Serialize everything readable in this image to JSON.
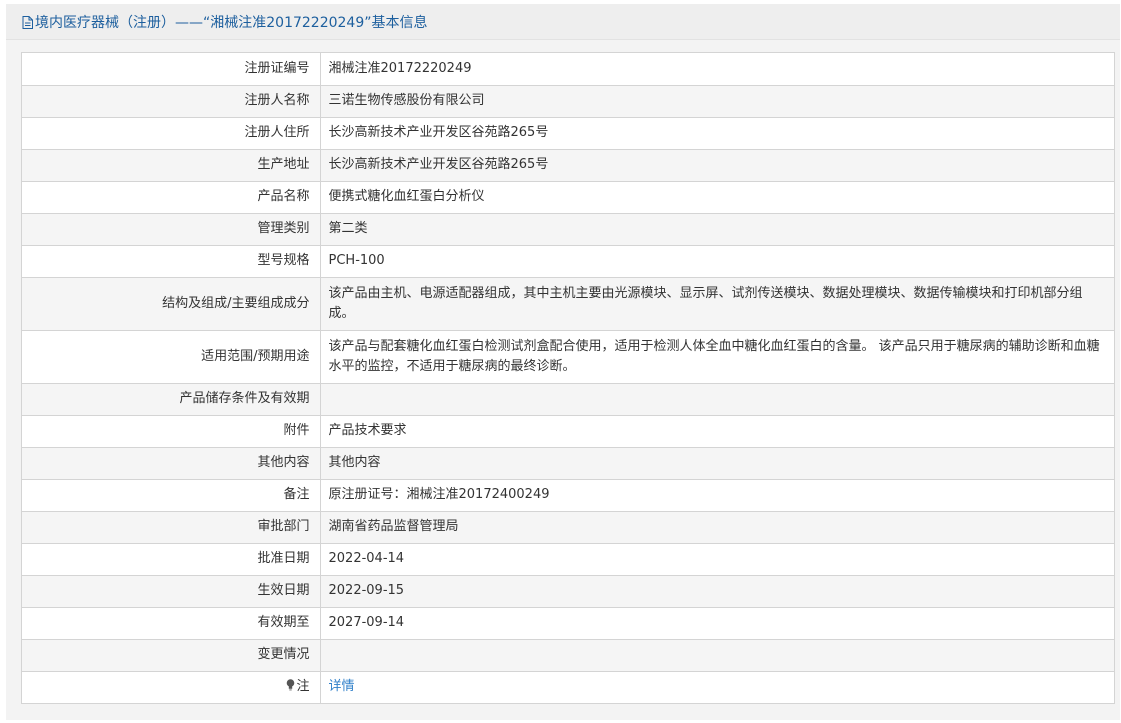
{
  "header": {
    "title": "境内医疗器械（注册）——“湘械注准20172220249”基本信息"
  },
  "rows": [
    {
      "label": "注册证编号",
      "value": "湘械注准20172220249"
    },
    {
      "label": "注册人名称",
      "value": "三诺生物传感股份有限公司"
    },
    {
      "label": "注册人住所",
      "value": "长沙高新技术产业开发区谷苑路265号"
    },
    {
      "label": "生产地址",
      "value": "长沙高新技术产业开发区谷苑路265号"
    },
    {
      "label": "产品名称",
      "value": "便携式糖化血红蛋白分析仪"
    },
    {
      "label": "管理类别",
      "value": "第二类"
    },
    {
      "label": "型号规格",
      "value": "PCH-100"
    },
    {
      "label": "结构及组成/主要组成成分",
      "value": "该产品由主机、电源适配器组成，其中主机主要由光源模块、显示屏、试剂传送模块、数据处理模块、数据传输模块和打印机部分组成。"
    },
    {
      "label": "适用范围/预期用途",
      "value": "该产品与配套糖化血红蛋白检测试剂盒配合使用，适用于检测人体全血中糖化血红蛋白的含量。 该产品只用于糖尿病的辅助诊断和血糖水平的监控，不适用于糖尿病的最终诊断。"
    },
    {
      "label": "产品储存条件及有效期",
      "value": ""
    },
    {
      "label": "附件",
      "value": "产品技术要求"
    },
    {
      "label": "其他内容",
      "value": "其他内容"
    },
    {
      "label": "备注",
      "value": "原注册证号：湘械注准20172400249"
    },
    {
      "label": "审批部门",
      "value": "湖南省药品监督管理局"
    },
    {
      "label": "批准日期",
      "value": "2022-04-14"
    },
    {
      "label": "生效日期",
      "value": "2022-09-15"
    },
    {
      "label": "有效期至",
      "value": "2027-09-14"
    },
    {
      "label": "变更情况",
      "value": ""
    },
    {
      "label": "注",
      "value": "详情"
    }
  ],
  "icons": {
    "header": "document-icon",
    "note": "lightbulb-icon"
  },
  "colors": {
    "title": "#1d5f9e",
    "link": "#2f7fc9",
    "row_alt": "#f5f5f5",
    "border": "#d4d4d4"
  }
}
